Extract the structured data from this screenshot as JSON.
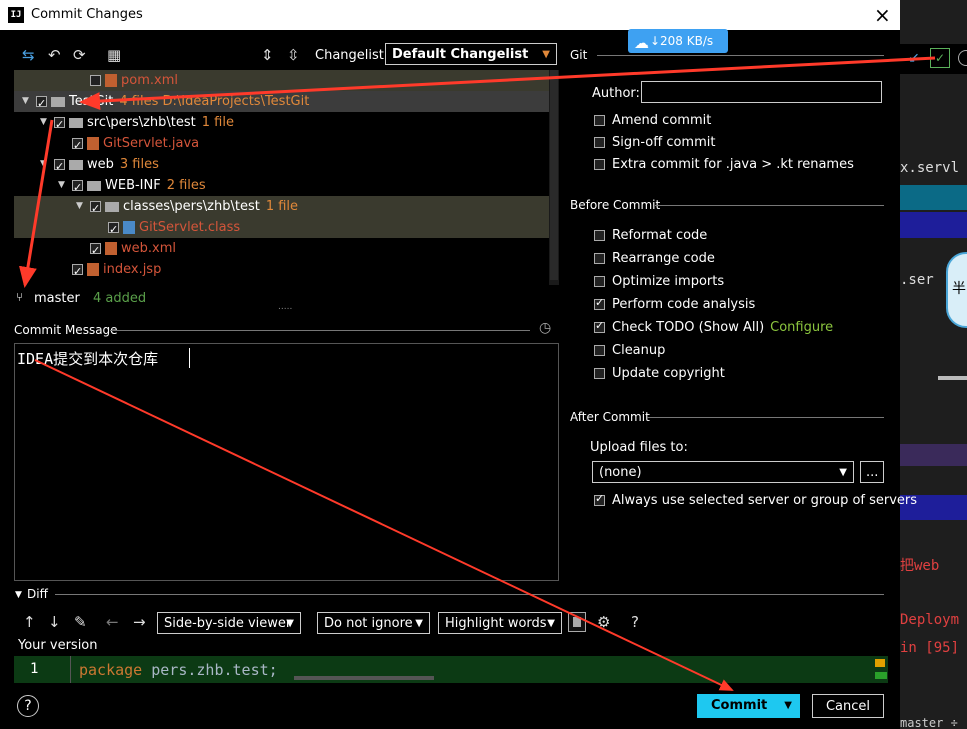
{
  "window": {
    "title": "Commit Changes",
    "logo": "IJ"
  },
  "overlay": {
    "speed": "208 KB/s"
  },
  "changelist": {
    "label": "Changelist:",
    "value": "Default Changelist"
  },
  "tree": [
    {
      "name": "pom.xml",
      "extra": "",
      "checked": false,
      "depth": 4,
      "kind": "xml",
      "cls": "red"
    },
    {
      "name": "TestGit",
      "extra": "4 files  D:\\IdeaProjects\\TestGit",
      "checked": true,
      "depth": 1,
      "kind": "folder",
      "cls": ""
    },
    {
      "name": "src\\pers\\zhb\\test",
      "extra": "1 file",
      "checked": true,
      "depth": 2,
      "kind": "folder",
      "cls": ""
    },
    {
      "name": "GitServlet.java",
      "extra": "",
      "checked": true,
      "depth": 3,
      "kind": "java",
      "cls": "red"
    },
    {
      "name": "web",
      "extra": "3 files",
      "checked": true,
      "depth": 2,
      "kind": "folder",
      "cls": ""
    },
    {
      "name": "WEB-INF",
      "extra": "2 files",
      "checked": true,
      "depth": 3,
      "kind": "folder",
      "cls": ""
    },
    {
      "name": "classes\\pers\\zhb\\test",
      "extra": "1 file",
      "checked": true,
      "depth": 4,
      "kind": "folder",
      "cls": ""
    },
    {
      "name": "GitServlet.class",
      "extra": "",
      "checked": true,
      "depth": 5,
      "kind": "class",
      "cls": "red"
    },
    {
      "name": "web.xml",
      "extra": "",
      "checked": true,
      "depth": 4,
      "kind": "xml",
      "cls": "red"
    },
    {
      "name": "index.jsp",
      "extra": "",
      "checked": true,
      "depth": 3,
      "kind": "jsp",
      "cls": "red"
    }
  ],
  "branch": {
    "name": "master",
    "status": "4 added"
  },
  "commit_message": {
    "label": "Commit Message",
    "text": "IDEA提交到本次仓库"
  },
  "git": {
    "section": "Git",
    "author_label": "Author:",
    "author_value": "",
    "options": [
      {
        "label": "Amend commit",
        "checked": false
      },
      {
        "label": "Sign-off commit",
        "checked": false
      },
      {
        "label": "Extra commit for .java > .kt renames",
        "checked": false
      }
    ]
  },
  "before_commit": {
    "section": "Before Commit",
    "options": [
      {
        "label": "Reformat code",
        "checked": false
      },
      {
        "label": "Rearrange code",
        "checked": false
      },
      {
        "label": "Optimize imports",
        "checked": false
      },
      {
        "label": "Perform code analysis",
        "checked": true
      },
      {
        "label": "Check TODO (Show All)",
        "checked": true
      },
      {
        "label": "Cleanup",
        "checked": false
      },
      {
        "label": "Update copyright",
        "checked": false
      }
    ],
    "configure_link": "Configure"
  },
  "after_commit": {
    "section": "After Commit",
    "upload_label": "Upload files to:",
    "upload_value": "(none)",
    "browse": "...",
    "always_use": "Always use selected server or group of servers",
    "always_use_checked": true
  },
  "diff": {
    "section": "Diff",
    "viewer": "Side-by-side viewer",
    "ignore": "Do not ignore",
    "highlight": "Highlight words",
    "help": "?",
    "your_version": "Your version",
    "line_number": "1",
    "code_keyword": "package",
    "code_rest": "pers.zhb.test;"
  },
  "buttons": {
    "commit": "Commit",
    "cancel": "Cancel",
    "help": "?"
  },
  "background_ide": {
    "lines": [
      "x.servl",
      ".ser",
      "把web",
      "Deploym",
      "in [95]",
      "master ÷"
    ],
    "badge": "半"
  },
  "colors": {
    "commit_button": "#1ec8f0",
    "added": "#5aa04a",
    "link": "#8cc63f",
    "annotation_arrow": "#ff3a2a"
  }
}
